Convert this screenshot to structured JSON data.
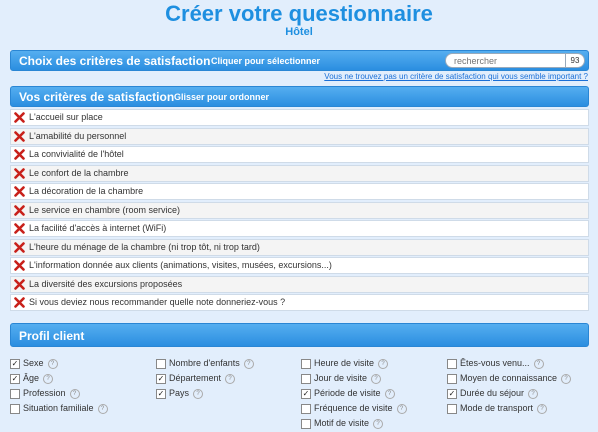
{
  "header": {
    "title": "Créer votre questionnaire",
    "subtitle": "Hôtel"
  },
  "choix": {
    "title": "Choix des critères de satisfaction",
    "hint": "Cliquer pour sélectionner",
    "search_placeholder": "rechercher",
    "count": "93"
  },
  "missing_link": "Vous ne trouvez pas un critère de satisfaction qui vous semble important ?",
  "vos": {
    "title": "Vos critères de satisfaction",
    "hint": "Glisser pour ordonner",
    "items": [
      "L'accueil sur place",
      "L'amabilité du personnel",
      "La convivialité de l'hôtel",
      "Le confort de la chambre",
      "La décoration de la chambre",
      "Le service en chambre (room service)",
      "La facilité d'accès à internet (WiFi)",
      "L'heure du ménage de la chambre (ni trop tôt, ni trop tard)",
      "L'information donnée aux clients (animations, visites, musées, excursions...)",
      "La diversité des excursions proposées",
      "Si vous deviez nous recommander quelle note donneriez-vous ?"
    ]
  },
  "profil": {
    "title": "Profil client",
    "columns": [
      [
        {
          "label": "Sexe",
          "checked": "✓"
        },
        {
          "label": "Âge",
          "checked": "✓"
        },
        {
          "label": "Profession",
          "checked": ""
        },
        {
          "label": "Situation familiale",
          "checked": ""
        }
      ],
      [
        {
          "label": "Nombre d'enfants",
          "checked": ""
        },
        {
          "label": "Département",
          "checked": "✓"
        },
        {
          "label": "Pays",
          "checked": "✓"
        }
      ],
      [
        {
          "label": "Heure de visite",
          "checked": ""
        },
        {
          "label": "Jour de visite",
          "checked": ""
        },
        {
          "label": "Période de visite",
          "checked": "✓"
        },
        {
          "label": "Fréquence de visite",
          "checked": ""
        },
        {
          "label": "Motif de visite",
          "checked": ""
        }
      ],
      [
        {
          "label": "Êtes-vous venu...",
          "checked": ""
        },
        {
          "label": "Moyen de connaissance",
          "checked": ""
        },
        {
          "label": "Durée du séjour",
          "checked": "✓"
        },
        {
          "label": "Mode de transport",
          "checked": ""
        }
      ]
    ]
  }
}
